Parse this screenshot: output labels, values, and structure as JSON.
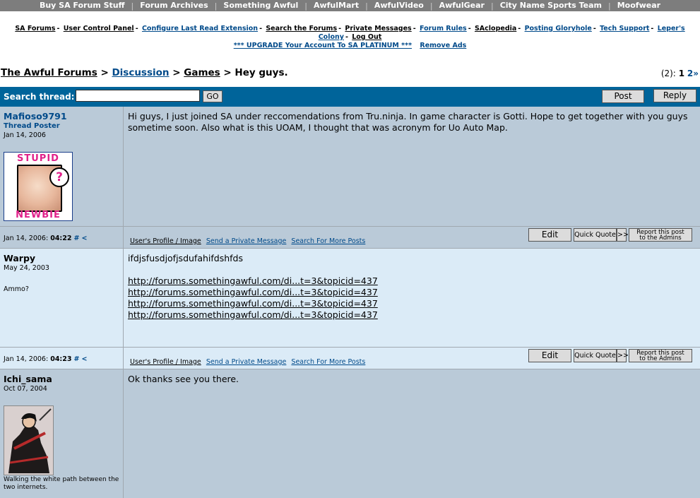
{
  "topnav": [
    "Buy SA Forum Stuff",
    "Forum Archives",
    "Something Awful",
    "AwfulMart",
    "AwfulVideo",
    "AwfulGear",
    "City Name Sports Team",
    "Moofwear"
  ],
  "subnav": {
    "line1": [
      "SA Forums",
      "User Control Panel",
      "Configure Last Read Extension",
      "Search the Forums",
      "Private Messages",
      "Forum Rules",
      "SAclopedia",
      "Posting Gloryhole",
      "Tech Support",
      "Leper's Colony",
      "Log Out"
    ],
    "upgrade": "*** UPGRADE Your Account To SA PLATINUM ***",
    "remove_ads": "Remove Ads"
  },
  "breadcrumb": {
    "forums": "The Awful Forums",
    "sep": ">",
    "discussion": "Discussion",
    "games": "Games",
    "thread": "Hey guys."
  },
  "pages": {
    "count": "(2):",
    "current": "1",
    "next": "2",
    "more": "»"
  },
  "threadbar": {
    "search_label": "Search thread:",
    "go": "GO",
    "post": "Post",
    "reply": "Reply"
  },
  "footer_labels": {
    "profile": "User's Profile / Image",
    "pm": "Send a Private Message",
    "search": "Search For More Posts",
    "edit": "Edit",
    "quote": "Quick Quote",
    "arrow": ">>",
    "report1": "Report this post",
    "report2": "to the Admins",
    "hash": "#",
    "lt": "<"
  },
  "posts": [
    {
      "username": "Mafioso9791",
      "title": "Thread Poster",
      "joined": "Jan 14, 2006",
      "avatar_top": "STUPID",
      "avatar_bottom": "NEWBIE",
      "avatar_q": "?",
      "body": "Hi guys, I just joined SA under reccomendations from Tru.ninja. In game character is Gotti. Hope to get together with you guys sometime soon. Also what is this UOAM, I thought that was acronym for Uo Auto Map.",
      "date": "Jan 14, 2006:",
      "time": "04:22"
    },
    {
      "username": "Warpy",
      "joined": "May 24, 2003",
      "user_text": "Ammo?",
      "body": "ifdjsfusdjofjsdufahifdshfds",
      "links": [
        "http://forums.somethingawful.com/di...t=3&topicid=437",
        "http://forums.somethingawful.com/di...t=3&topicid=437",
        "http://forums.somethingawful.com/di...t=3&topicid=437",
        "http://forums.somethingawful.com/di...t=3&topicid=437"
      ],
      "date": "Jan 14, 2006:",
      "time": "04:23"
    },
    {
      "username": "Ichi_sama",
      "joined": "Oct 07, 2004",
      "user_text": "Walking the white path between the two internets.",
      "body": "Ok thanks see you there."
    }
  ]
}
